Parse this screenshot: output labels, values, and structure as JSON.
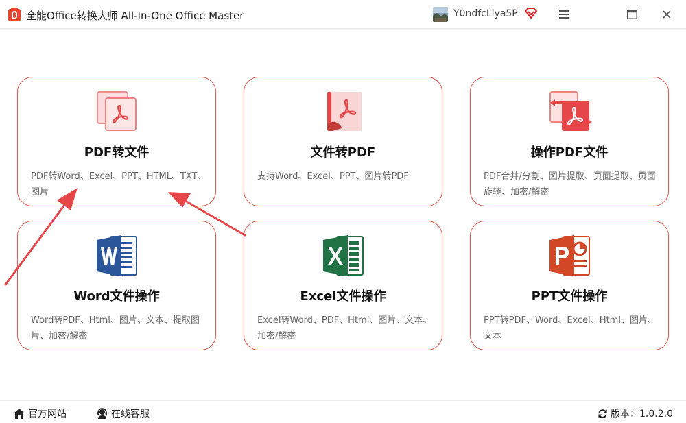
{
  "window": {
    "title": "全能Office转换大师 All-In-One Office Master",
    "user_name": "Y0ndfcLlya5P"
  },
  "cards": [
    {
      "title": "PDF转文件",
      "desc": "PDF转Word、Excel、PPT、HTML、TXT、图片",
      "icon": "pdf-files-icon"
    },
    {
      "title": "文件转PDF",
      "desc": "支持Word、Excel、PPT、图片转PDF",
      "icon": "file-to-pdf-icon"
    },
    {
      "title": "操作PDF文件",
      "desc": "PDF合并/分割、图片提取、页面提取、页面旋转、加密/解密",
      "icon": "pdf-operations-icon"
    },
    {
      "title": "Word文件操作",
      "desc": "Word转PDF、Html、图片、文本、提取图片、加密/解密",
      "icon": "word-icon"
    },
    {
      "title": "Excel文件操作",
      "desc": "Excel转Word、PDF、Html、图片、文本、加密/解密",
      "icon": "excel-icon"
    },
    {
      "title": "PPT文件操作",
      "desc": "PPT转PDF、Word、Excel、Html、图片、文本",
      "icon": "powerpoint-icon"
    }
  ],
  "footer": {
    "website_label": "官方网站",
    "service_label": "在线客服",
    "version_label": "版本：1.0.2.0"
  },
  "colors": {
    "accent": "#e0574a",
    "pdf_red": "#e8474a",
    "word_blue": "#2b579a",
    "excel_green": "#217346",
    "ppt_red": "#d24726"
  }
}
